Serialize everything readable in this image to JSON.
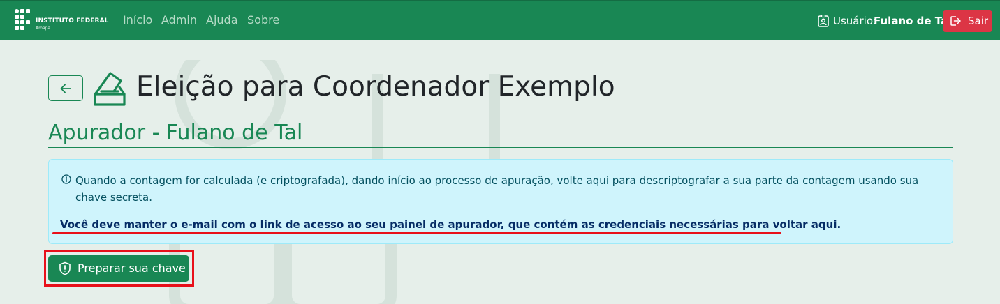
{
  "navbar": {
    "brand_title": "INSTITUTO FEDERAL",
    "brand_subtitle": "Amapá",
    "links": [
      "Início",
      "Admin",
      "Ajuda",
      "Sobre"
    ],
    "user_label": "Usuário:",
    "user_name": "Fulano de Tal",
    "logout_label": "Sair",
    "colors": {
      "bar": "#198754",
      "logout": "#dc3545"
    }
  },
  "header": {
    "title": "Eleição para Coordenador Exemplo",
    "back_icon": "arrow-left-icon",
    "title_icon": "ballot-box-icon"
  },
  "section": {
    "title": "Apurador - Fulano de Tal"
  },
  "alert": {
    "icon": "info-circle-icon",
    "message": "Quando a contagem for calculada (e criptografada), dando início ao processo de apuração, volte aqui para descriptografar a sua parte da contagem usando sua chave secreta.",
    "emphasis": "Você deve manter o e-mail com o link de acesso ao seu painel de apurador, que contém as credenciais necessárias para voltar aqui."
  },
  "actions": {
    "prepare_key_label": "Preparar sua chave",
    "prepare_key_icon": "shield-exclamation-icon"
  },
  "annotations": {
    "highlight_color": "#e8101a"
  }
}
